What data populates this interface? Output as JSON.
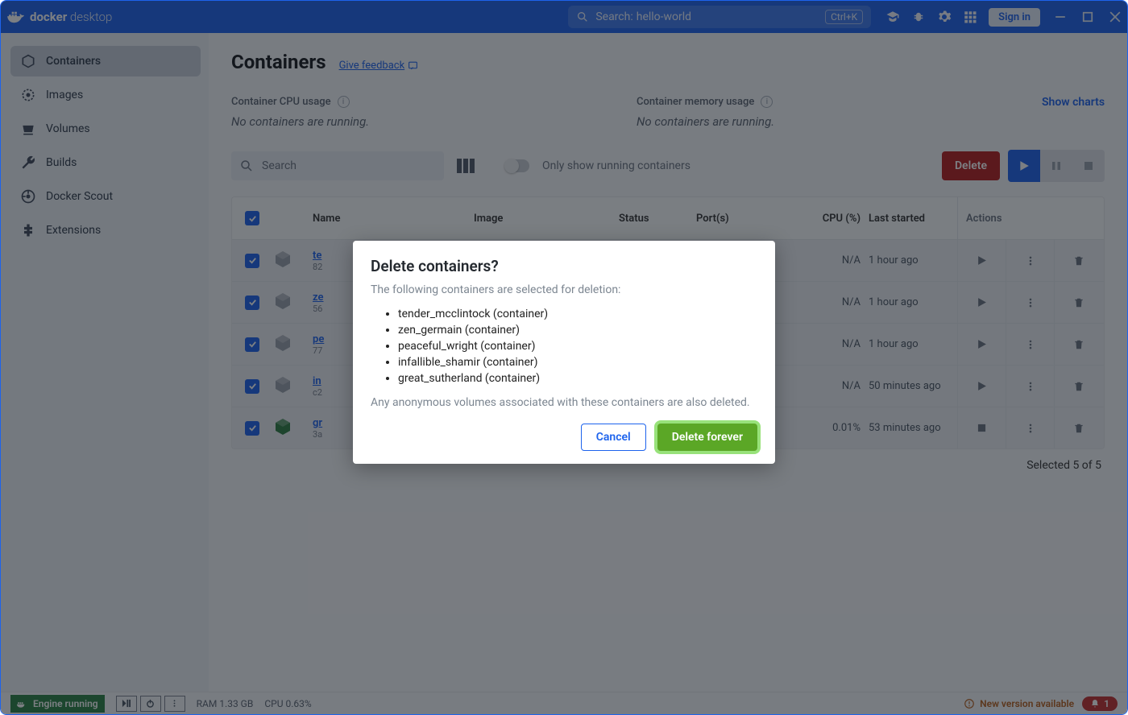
{
  "titlebar": {
    "brand_bold": "docker",
    "brand_light": "desktop",
    "search_prefix": "Search:",
    "search_value": "hello-world",
    "shortcut": "Ctrl+K",
    "signin": "Sign in"
  },
  "sidebar": {
    "items": [
      {
        "label": "Containers"
      },
      {
        "label": "Images"
      },
      {
        "label": "Volumes"
      },
      {
        "label": "Builds"
      },
      {
        "label": "Docker Scout"
      },
      {
        "label": "Extensions"
      }
    ]
  },
  "page": {
    "title": "Containers",
    "feedback": "Give feedback",
    "cpu_label": "Container CPU usage",
    "cpu_val": "No containers are running.",
    "mem_label": "Container memory usage",
    "mem_val": "No containers are running.",
    "show_charts": "Show charts"
  },
  "toolbar": {
    "search_placeholder": "Search",
    "only_running": "Only show running containers",
    "delete": "Delete"
  },
  "table": {
    "headers": {
      "name": "Name",
      "image": "Image",
      "status": "Status",
      "ports": "Port(s)",
      "cpu": "CPU (%)",
      "last": "Last started",
      "actions": "Actions"
    },
    "rows": [
      {
        "name": "te",
        "sub": "82",
        "status_icon": "gray",
        "cpu": "N/A",
        "last": "1 hour ago",
        "play": true,
        "green": false
      },
      {
        "name": "ze",
        "sub": "56",
        "status_icon": "gray",
        "cpu": "N/A",
        "last": "1 hour ago",
        "play": true,
        "green": false
      },
      {
        "name": "pe",
        "sub": "77",
        "status_icon": "gray",
        "cpu": "N/A",
        "last": "1 hour ago",
        "play": true,
        "green": false
      },
      {
        "name": "in",
        "sub": "c2",
        "status_icon": "gray",
        "cpu": "N/A",
        "last": "50 minutes ago",
        "play": true,
        "green": false
      },
      {
        "name": "gr",
        "sub": "3a",
        "status_icon": "green",
        "cpu": "0.01%",
        "last": "53 minutes ago",
        "play": false,
        "green": true
      }
    ],
    "selected_text": "Selected 5 of 5"
  },
  "statusbar": {
    "engine": "Engine running",
    "ram": "RAM 1.33 GB",
    "cpu": "CPU 0.63%",
    "new_version": "New version available",
    "notif_count": "1"
  },
  "modal": {
    "title": "Delete containers?",
    "subtitle": "The following containers are selected for deletion:",
    "items": [
      "tender_mcclintock (container)",
      "zen_germain (container)",
      "peaceful_wright (container)",
      "infallible_shamir (container)",
      "great_sutherland (container)"
    ],
    "footer": "Any anonymous volumes associated with these containers are also deleted.",
    "cancel": "Cancel",
    "delete_forever": "Delete forever"
  }
}
